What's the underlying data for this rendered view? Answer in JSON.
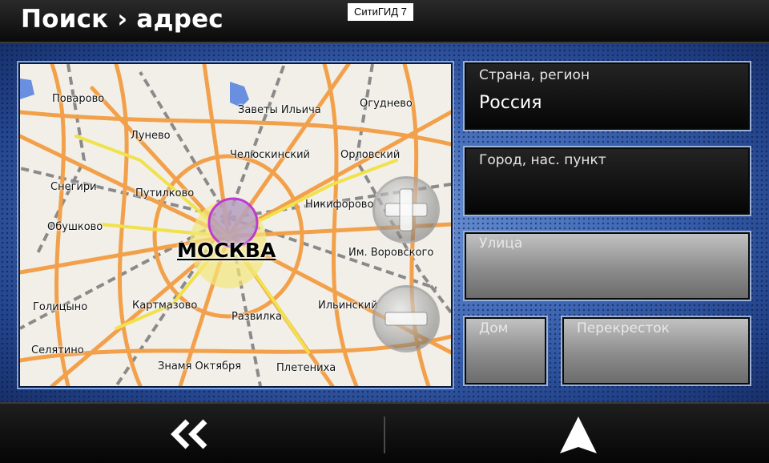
{
  "header": {
    "title": "Поиск › адрес",
    "app_name": "СитиГИД 7"
  },
  "map": {
    "city": "МОСКВА",
    "places": [
      "Поварово",
      "Заветы Ильича",
      "Огуднево",
      "Лунево",
      "Челюскинский",
      "Орловский",
      "Снегири",
      "Путилково",
      "Никифорово",
      "Обушково",
      "Им. Воровского",
      "Голицыно",
      "Картмазово",
      "Развилка",
      "Ильинский",
      "Селятино",
      "Знамя Октября",
      "Плетениха"
    ],
    "zoom_in_icon": "plus-icon",
    "zoom_out_icon": "minus-icon"
  },
  "fields": {
    "country": {
      "label": "Страна, регион",
      "value": "Россия"
    },
    "city": {
      "label": "Город, нас. пункт",
      "value": ""
    },
    "street": {
      "label": "Улица"
    },
    "house": {
      "label": "Дом"
    },
    "crossing": {
      "label": "Перекресток"
    }
  },
  "footer": {
    "back_icon": "double-chevron-left-icon",
    "go_icon": "navigation-arrow-icon"
  },
  "colors": {
    "road_major": "#f2a04a",
    "road_minor": "#f3e04a",
    "rail": "#8c8c8c",
    "map_bg": "#f1efe8",
    "panel_blue": "#3f68b6"
  }
}
